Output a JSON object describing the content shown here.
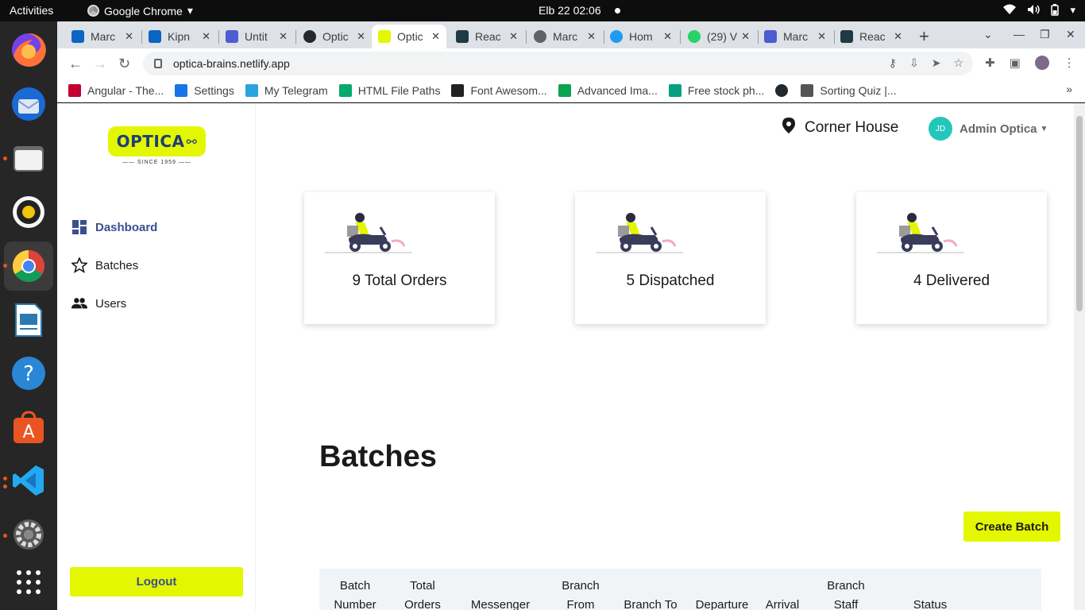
{
  "system": {
    "activities": "Activities",
    "app_name": "Google Chrome",
    "clock": "Elb 22  02:06"
  },
  "tabs": [
    {
      "label": "Marc",
      "icon": "linkedin-icon",
      "color": "#0a66c2"
    },
    {
      "label": "Kipn",
      "icon": "linkedin-icon",
      "color": "#0a66c2"
    },
    {
      "label": "Untit",
      "icon": "docs-icon",
      "color": "#4d5ccf"
    },
    {
      "label": "Optic",
      "icon": "github-icon",
      "color": "#24292f"
    },
    {
      "label": "Optic",
      "icon": "optica-icon",
      "color": "#e3f700"
    },
    {
      "label": "Reac",
      "icon": "react-icon",
      "color": "#1e3a45"
    },
    {
      "label": "Marc",
      "icon": "globe-icon",
      "color": "#5f6368"
    },
    {
      "label": "Hom",
      "icon": "twitter-icon",
      "color": "#1d9bf0"
    },
    {
      "label": "(29) V",
      "icon": "whatsapp-icon",
      "color": "#25d366"
    },
    {
      "label": "Marc",
      "icon": "docs-icon",
      "color": "#4d5ccf"
    },
    {
      "label": "Reac",
      "icon": "react-icon",
      "color": "#1e3a45"
    }
  ],
  "url": "optica-brains.netlify.app",
  "bookmarks": [
    {
      "label": "Angular - The...",
      "color": "#c3002f"
    },
    {
      "label": "Settings",
      "color": "#1a73e8"
    },
    {
      "label": "My Telegram",
      "color": "#2aa3df"
    },
    {
      "label": "HTML File Paths",
      "color": "#04aa6d"
    },
    {
      "label": "Font Awesom...",
      "color": "#222"
    },
    {
      "label": "Advanced Ima...",
      "color": "#0aa34f"
    },
    {
      "label": "Free stock ph...",
      "color": "#05a081"
    },
    {
      "label": "",
      "color": "#24292f"
    },
    {
      "label": "Sorting Quiz |...",
      "color": "#555"
    }
  ],
  "logo": {
    "name": "OPTICA",
    "since": "SINCE 1959"
  },
  "nav": {
    "dashboard": "Dashboard",
    "batches": "Batches",
    "users": "Users"
  },
  "logout": "Logout",
  "header": {
    "location": "Corner House",
    "user_initials": "JD",
    "user_name": "Admin Optica"
  },
  "stats": [
    {
      "label": "9 Total Orders"
    },
    {
      "label": "5 Dispatched"
    },
    {
      "label": "4 Delivered"
    }
  ],
  "page_title": "Batches",
  "create_button": "Create Batch",
  "table_headers": [
    {
      "line1": "Batch",
      "line2": "Number"
    },
    {
      "line1": "Total",
      "line2": "Orders"
    },
    {
      "line1": "",
      "line2": "Messenger"
    },
    {
      "line1": "Branch",
      "line2": "From"
    },
    {
      "line1": "",
      "line2": "Branch To"
    },
    {
      "line1": "",
      "line2": "Departure"
    },
    {
      "line1": "",
      "line2": "Arrival"
    },
    {
      "line1": "Branch",
      "line2": "Staff"
    },
    {
      "line1": "",
      "line2": "Status"
    }
  ]
}
